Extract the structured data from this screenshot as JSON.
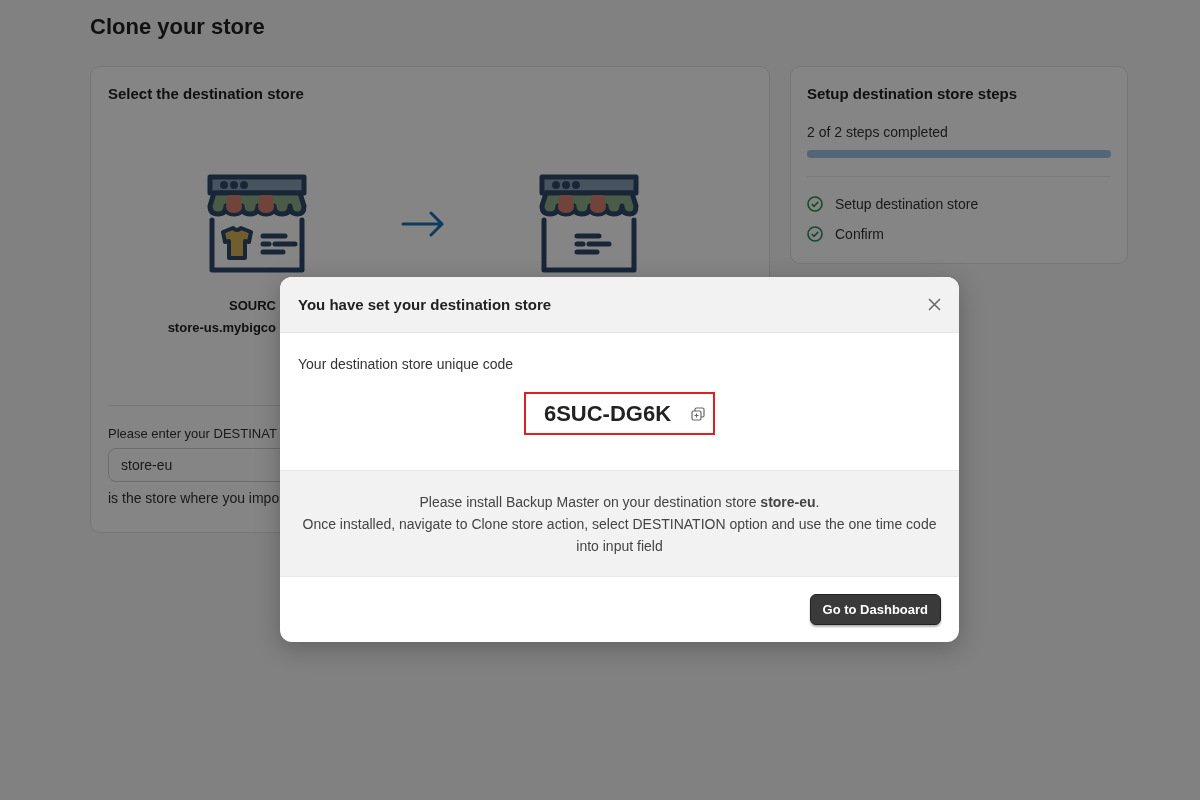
{
  "page": {
    "title": "Clone your store"
  },
  "destination_card": {
    "title": "Select the destination store",
    "source_label": "SOURC",
    "source_store": "store-us.mybigco",
    "input_label": "Please enter your DESTINAT",
    "input": {
      "value": "store-eu"
    },
    "hint": "is the store where you impo"
  },
  "steps_card": {
    "title": "Setup destination store steps",
    "progress_text": "2 of 2 steps completed",
    "level": 1,
    "steps": [
      {
        "label": "Setup destination store",
        "checked": true
      },
      {
        "label": "Confirm",
        "checked": true
      }
    ]
  },
  "modal": {
    "title": "You have set your destination store",
    "code_label": "Your destination store unique code",
    "code": "6SUC-DG6K",
    "message_lines": [
      "Please install Backup Master on your destination store **store-eu**.",
      "Once installed, navigate to Clone store action, select DESTINATION option and use the one time code into input field"
    ],
    "button": "Go to Dashboard"
  }
}
